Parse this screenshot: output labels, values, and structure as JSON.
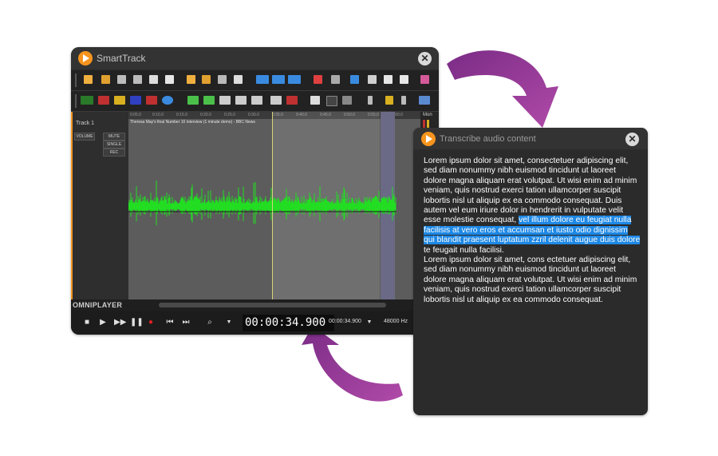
{
  "smarttrack": {
    "title": "SmartTrack",
    "track_name": "Track 1",
    "volume_label": "VOLUME",
    "mute_label": "MUTE",
    "single_label": "SINGLE",
    "rec_label": "REC",
    "clip_name": "Theresa May's final Number 10 interview (1 minute demo) - BBC News",
    "ruler_ticks": [
      "0:05.0",
      "0:10.0",
      "0:15.0",
      "0:20.0",
      "0:25.0",
      "0:30.0",
      "0:35.0",
      "0:40.0",
      "0:45.0",
      "0:50.0",
      "0:55.0",
      "1:00.0"
    ],
    "meter_label": "Mon",
    "player_brand": "OMNIPLAYER",
    "time_display": "00:00:34.900",
    "time_small": "00:00:34.900",
    "sample_rate": "48000 Hz"
  },
  "transcribe": {
    "title": "Transcribe audio content",
    "text_before": "Lorem ipsum dolor sit amet, consectetuer adipiscing elit, sed diam nonummy nibh euismod tincidunt ut laoreet dolore magna aliquam erat volutpat. Ut wisi enim ad minim veniam, quis nostrud exerci tation ullamcorper suscipit lobortis nisl ut aliquip ex ea commodo consequat. Duis autem vel eum iriure dolor in hendrerit in vulputate velit esse molestie consequat, ",
    "text_highlight": "vel illum dolore eu feugiat nulla facilisis at vero eros et accumsan et iusto odio dignissim qui blandit praesent luptatum zzril delenit augue duis dolore",
    "text_after": " te feugait nulla facilisi.",
    "text_para2": "Lorem ipsum dolor sit amet, cons ectetuer adipiscing elit, sed diam nonummy nibh euismod tincidunt ut laoreet dolore magna aliquam erat volutpat. Ut wisi enim ad minim veniam, quis nostrud exerci tation ullamcorper suscipit lobortis nisl ut aliquip ex ea commodo consequat."
  },
  "colors": {
    "accent": "#f7941d",
    "waveform": "#22dd22",
    "highlight": "#1e88e5",
    "arrow": "#a03c9c"
  },
  "icons": {
    "toolbar_1": [
      "paste-icon",
      "open-icon",
      "import-icon",
      "export-icon",
      "save-icon",
      "print-icon",
      "folder-icon",
      "clip-icon",
      "record-icon",
      "copy-icon",
      "waveform-icon",
      "split-icon",
      "merge-icon",
      "undo-icon",
      "redo-icon",
      "select-icon",
      "cut-icon",
      "duplicate-icon",
      "paste-clip-icon",
      "eraser-icon"
    ],
    "toolbar_2": [
      "fade-icon",
      "effect-icon",
      "marker-icon",
      "normalize-icon",
      "loop-icon",
      "wave-icon",
      "envelope-icon",
      "trim-icon",
      "cursor-icon",
      "move-icon",
      "snap-icon",
      "gain-icon",
      "tempo-icon",
      "mix-icon",
      "add-icon",
      "tools-icon"
    ]
  }
}
